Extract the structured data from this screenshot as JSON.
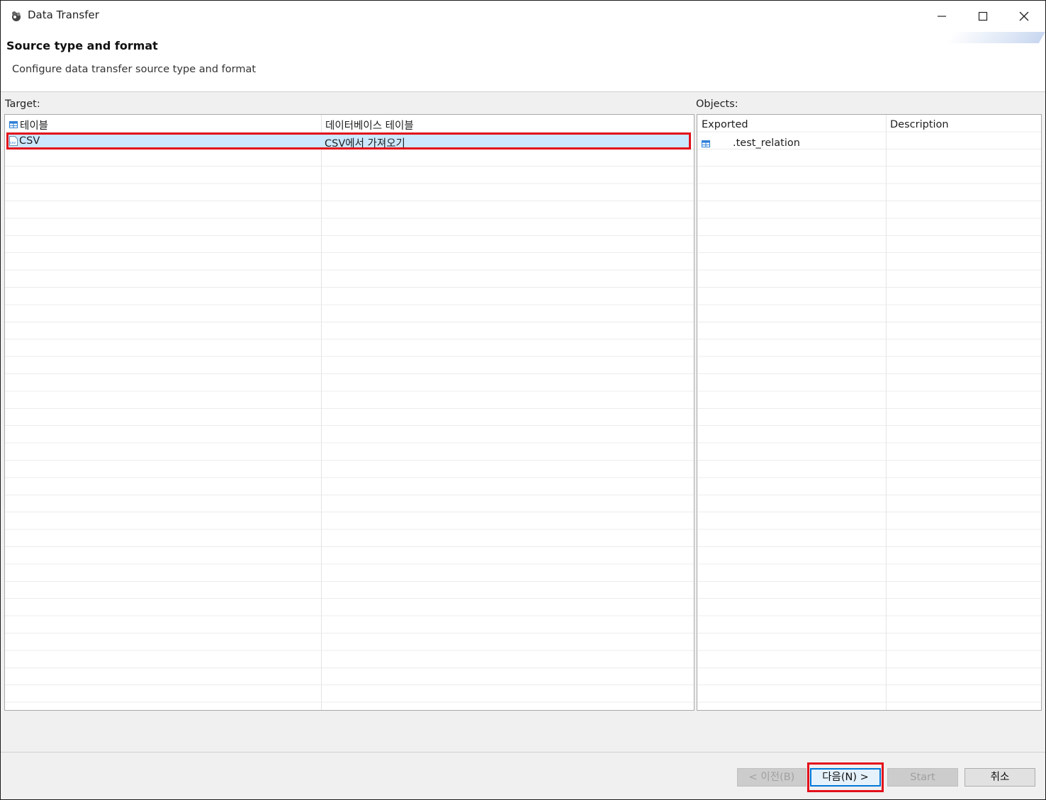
{
  "window": {
    "title": "Data Transfer"
  },
  "header": {
    "title": "Source type and format",
    "description": "Configure data transfer source type and format"
  },
  "target": {
    "label": "Target:",
    "rows": [
      {
        "name": "테이블",
        "description": "데이터베이스 테이블",
        "icon": "table-icon",
        "selected": false
      },
      {
        "name": "CSV",
        "description": "CSV에서 가져오기",
        "icon": "csv-file-icon",
        "selected": true
      }
    ]
  },
  "objects": {
    "label": "Objects:",
    "columns": [
      "Exported",
      "Description"
    ],
    "rows": [
      {
        "exported": ".test_relation",
        "description": "",
        "icon": "table-icon"
      }
    ]
  },
  "buttons": {
    "back": "< 이전(B)",
    "next": "다음(N) >",
    "start": "Start",
    "cancel": "취소"
  },
  "colors": {
    "selection": "#cce8ff",
    "highlight_border": "#e3101b",
    "focus_border": "#0078d7"
  }
}
